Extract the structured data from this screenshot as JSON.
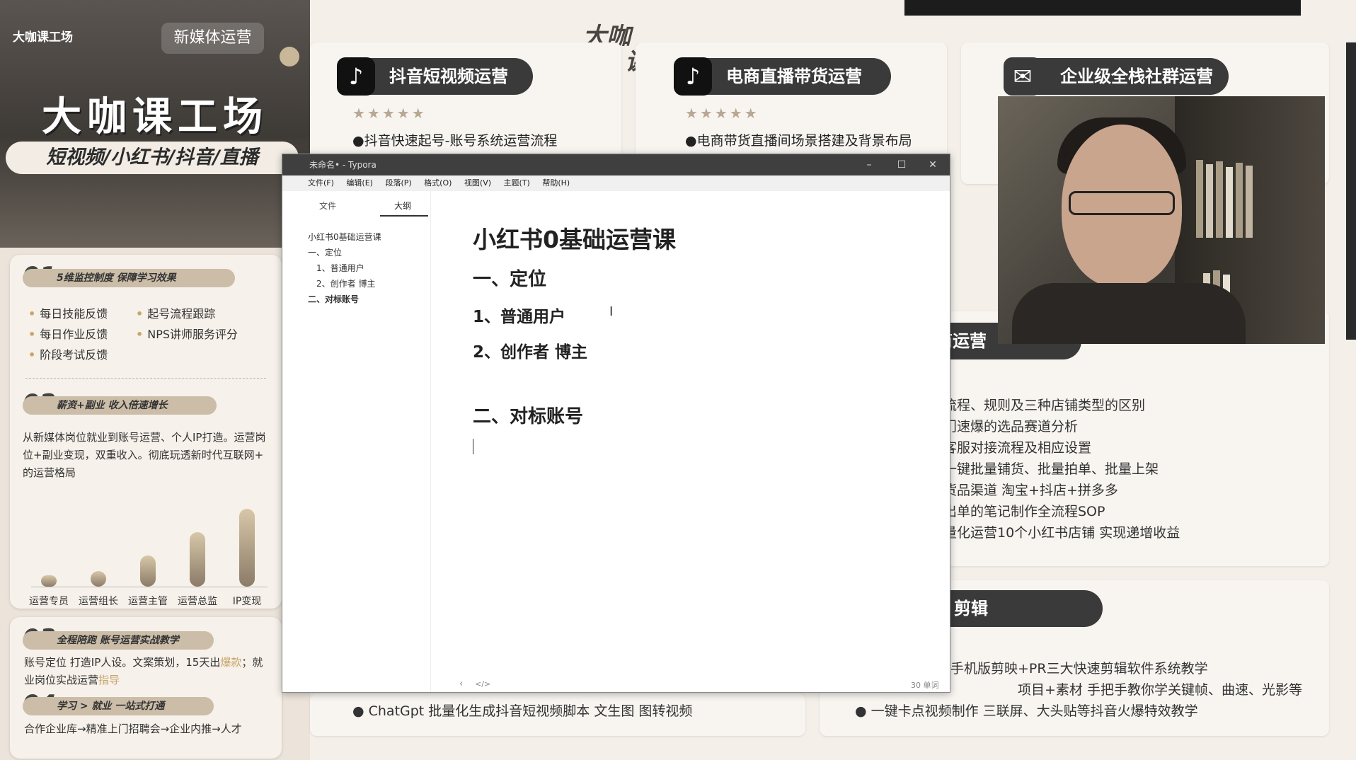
{
  "left_banner": {
    "brand": "大咖课工场",
    "chip": "新媒体运营",
    "title": "大咖课工场",
    "subtitle": "短视频/小红书/抖音/直播",
    "sec1": {
      "num": "01",
      "tag": "5维监控制度 保障学习效果",
      "items": [
        "每日技能反馈",
        "起号流程跟踪",
        "每日作业反馈",
        "NPS讲师服务评分",
        "阶段考试反馈"
      ]
    },
    "sec2": {
      "num": "02",
      "tag": "薪资+副业 收入倍速增长",
      "text": "从新媒体岗位就业到账号运营、个人IP打造。运营岗位+副业变现，双重收入。彻底玩透新时代互联网+ 的运营格局",
      "chart_data": {
        "type": "bar",
        "categories": [
          "运营专员",
          "运营组长",
          "运营主管",
          "运营总监",
          "IP变现"
        ],
        "values": [
          1,
          2,
          4,
          7,
          10
        ]
      }
    },
    "sec3": {
      "num": "03",
      "tag": "全程陪跑 账号运营实战教学",
      "text1": "账号定位 打造IP人设。文案策划，15天出",
      "hl1": "爆款",
      "text2": "；就业岗位实战运营",
      "hl2": "指导"
    },
    "sec4": {
      "num": "04",
      "tag": "学习 > 就业 一站式打通",
      "text": "合作企业库→精准上门招聘会→企业内推→人才"
    }
  },
  "poster": {
    "logo_top": "大咖",
    "logo_bottom": "课堂",
    "course1": {
      "title": "抖音短视频运营",
      "point": "●抖音快速起号-账号系统运营流程",
      "bottom": "● ChatGpt 批量化生成抖音短视频脚本 文生图 图转视频"
    },
    "course2": {
      "title": "电商直播带货运营",
      "point": "●电商带货直播间场景搭建及背景布局"
    },
    "course3": {
      "title": "企业级全栈社群运营"
    },
    "ecom_title": "电商运营",
    "ecom_list": [
      "流程、规则及三种店铺类型的区别",
      "门速爆的选品赛道分析",
      "客服对接流程及相应设置",
      "一键批量铺货、批量拍单、批量上架",
      "货品渠道 淘宝+抖店+拼多多",
      "出单的笔记制作全流程SOP",
      "量化运营10个小红书店铺 实现递增收益"
    ],
    "edit_title": "剪辑",
    "edit_list": [
      "手机版剪映+PR三大快速剪辑软件系统教学",
      "项目+素材 手把手教你学关键帧、曲速、光影等",
      "● 一键卡点视频制作 三联屏、大头贴等抖音火爆特效教学"
    ]
  },
  "typora": {
    "window_title": "未命名• - Typora",
    "menu": [
      "文件(F)",
      "编辑(E)",
      "段落(P)",
      "格式(O)",
      "视图(V)",
      "主题(T)",
      "帮助(H)"
    ],
    "tab_files": "文件",
    "tab_outline": "大纲",
    "outline": [
      "小红书0基础运营课",
      "一、定位",
      "1、普通用户",
      "2、创作者 博主",
      "二、对标账号"
    ],
    "doc": {
      "h1": "小红书0基础运营课",
      "h2a": "一、定位",
      "h3a": "1、普通用户",
      "h3b": "2、创作者 博主",
      "h2b": "二、对标账号"
    },
    "word_count": "30 单词",
    "footer_icons": [
      "‹",
      "</>"
    ]
  }
}
